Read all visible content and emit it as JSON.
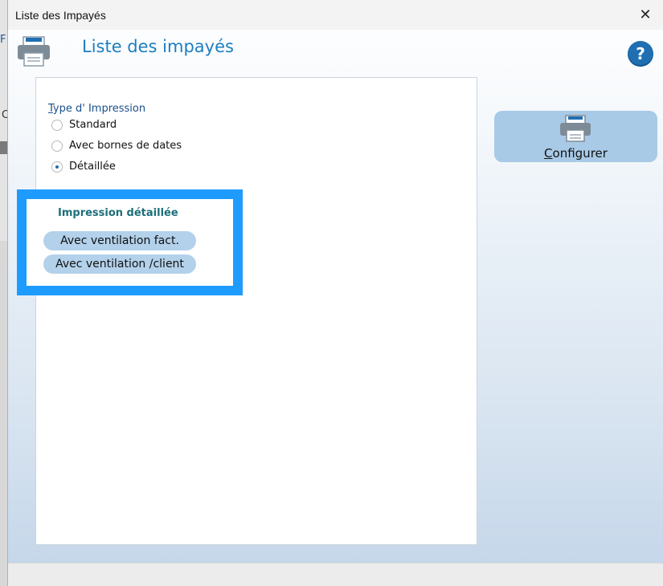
{
  "background": {
    "frag_top": "F",
    "frag_mid": "C"
  },
  "window": {
    "title": "Liste des Impayés",
    "close_glyph": "✕"
  },
  "header": {
    "title": "Liste des impayés",
    "help_glyph": "?"
  },
  "print_type": {
    "label_first": "T",
    "label_rest": "ype d' Impression",
    "options": [
      {
        "label": "Standard",
        "checked": false
      },
      {
        "label": "Avec bornes de dates",
        "checked": false
      },
      {
        "label": "Détaillée",
        "checked": true
      }
    ]
  },
  "detail": {
    "title": "Impression détaillée",
    "buttons": [
      {
        "label": "Avec ventilation fact."
      },
      {
        "label": "Avec ventilation /client"
      }
    ]
  },
  "configure": {
    "label_first": "C",
    "label_rest": "onfigurer"
  },
  "colors": {
    "accent": "#1d7ec0",
    "highlight": "#1e9bff",
    "pill": "#b3d1ea"
  }
}
